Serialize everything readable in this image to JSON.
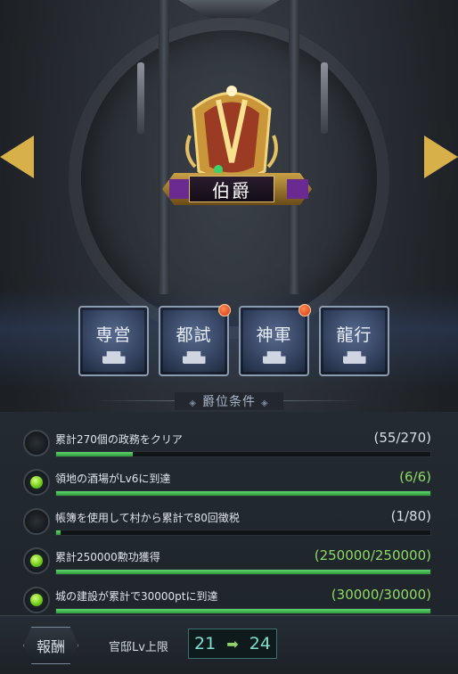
{
  "rank": {
    "title": "伯爵"
  },
  "tabs": [
    {
      "label": "専営",
      "badge": false
    },
    {
      "label": "都試",
      "badge": true
    },
    {
      "label": "神軍",
      "badge": true
    },
    {
      "label": "龍行",
      "badge": false
    }
  ],
  "section": {
    "title": "爵位条件"
  },
  "conditions": [
    {
      "text": "累計270個の政務をクリア",
      "value": "(55/270)",
      "done": false,
      "progress": 0.2037
    },
    {
      "text": "領地の酒場がLv6に到達",
      "value": "(6/6)",
      "done": true,
      "progress": 1.0
    },
    {
      "text": "帳簿を使用して村から累計で80回徴税",
      "value": "(1/80)",
      "done": false,
      "progress": 0.0125
    },
    {
      "text": "累計250000勲功獲得",
      "value": "(250000/250000)",
      "done": true,
      "progress": 1.0
    },
    {
      "text": "城の建設が累計で30000ptに到達",
      "value": "(30000/30000)",
      "done": true,
      "progress": 1.0
    }
  ],
  "reward": {
    "badge": "報酬",
    "label": "官邸Lv上限",
    "from": "21",
    "arrow": "➡",
    "to": "24"
  },
  "colors": {
    "accent_gold": "#d8b04a",
    "progress_green": "#5ed66d",
    "value_done": "#8edb63",
    "reward_cyan": "#7fe0d0"
  },
  "icons": {
    "nav_left": "chevron-left-icon",
    "nav_right": "chevron-right-icon",
    "crown": "crown-icon",
    "tab_icon": "pedestal-icon",
    "notification": "red-dot-icon",
    "check": "check-orb-icon"
  }
}
